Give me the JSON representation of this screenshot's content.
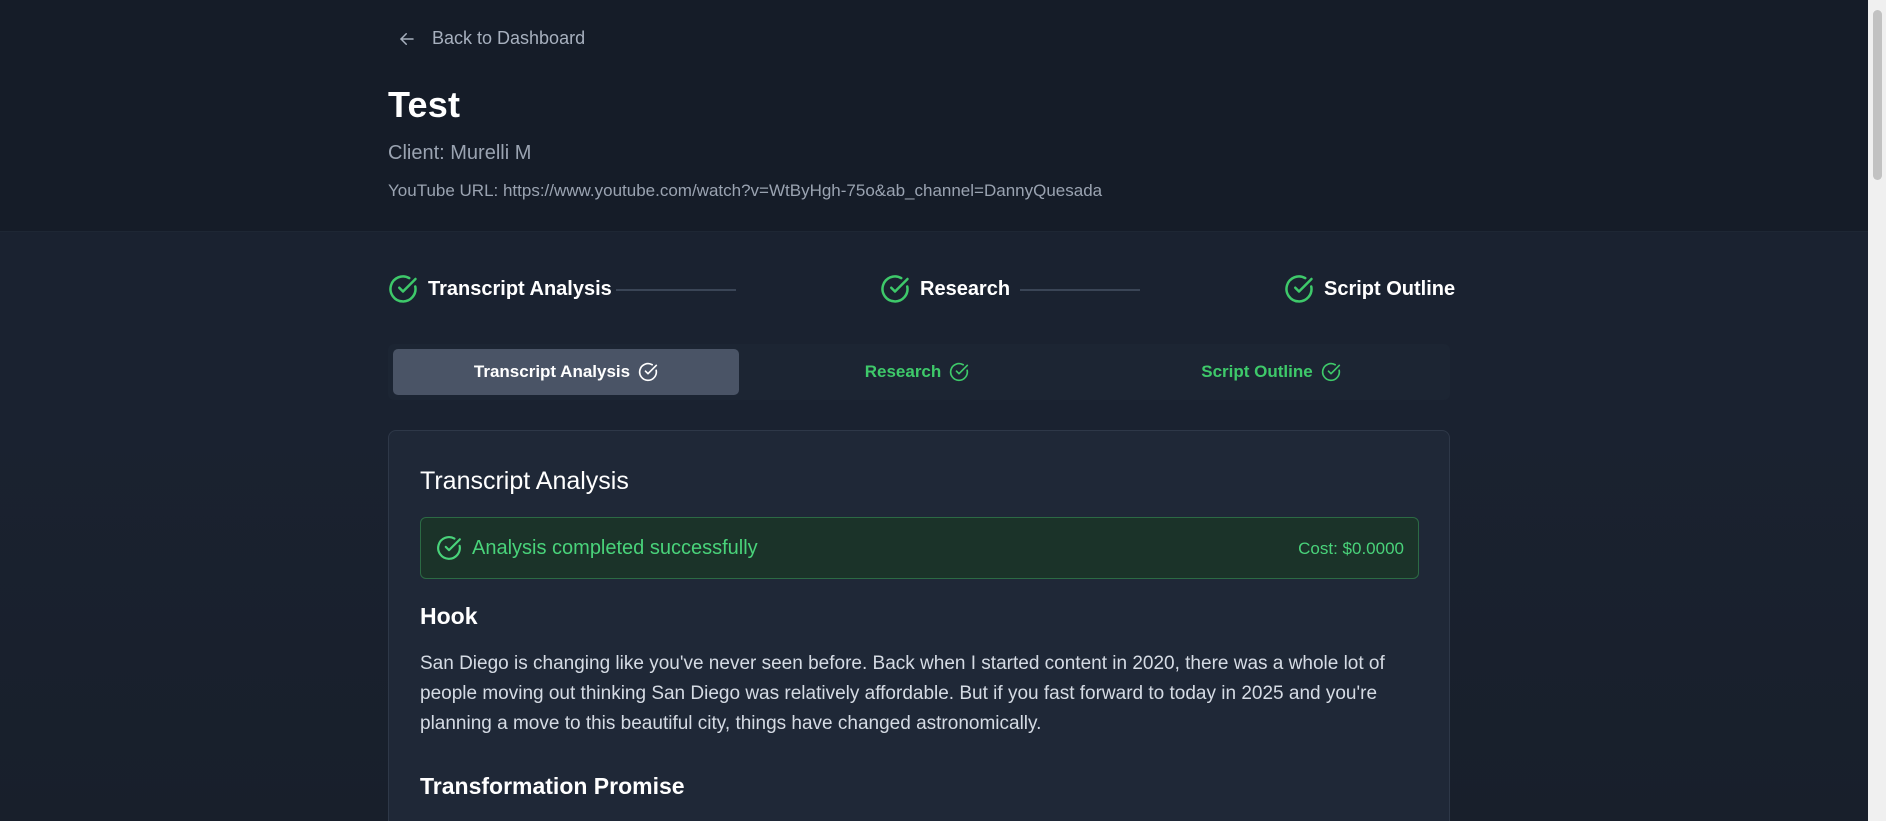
{
  "header": {
    "back_label": "Back to Dashboard",
    "title": "Test",
    "client": "Client: Murelli M",
    "youtube": "YouTube URL: https://www.youtube.com/watch?v=WtByHgh-75o&ab_channel=DannyQuesada"
  },
  "stepper": {
    "steps": [
      {
        "label": "Transcript Analysis",
        "status": "complete"
      },
      {
        "label": "Research",
        "status": "complete"
      },
      {
        "label": "Script Outline",
        "status": "complete"
      }
    ]
  },
  "tabs": [
    {
      "label": "Transcript Analysis",
      "active": true
    },
    {
      "label": "Research",
      "active": false
    },
    {
      "label": "Script Outline",
      "active": false
    }
  ],
  "card": {
    "title": "Transcript Analysis",
    "alert": {
      "message": "Analysis completed successfully",
      "cost": "Cost: $0.0000"
    },
    "sections": [
      {
        "heading": "Hook",
        "body": "San Diego is changing like you've never seen before. Back when I started content in 2020, there was a whole lot of people moving out thinking San Diego was relatively affordable. But if you fast forward to today in 2025 and you're planning a move to this beautiful city, things have changed astronomically."
      },
      {
        "heading": "Transformation Promise",
        "body": ""
      }
    ]
  },
  "colors": {
    "accent_green": "#49d37a",
    "background": "#1a2230",
    "card": "#1f2837",
    "active_tab": "#4a5466"
  },
  "icons": {
    "back": "arrow-left-icon",
    "step_complete": "check-circle-icon"
  }
}
